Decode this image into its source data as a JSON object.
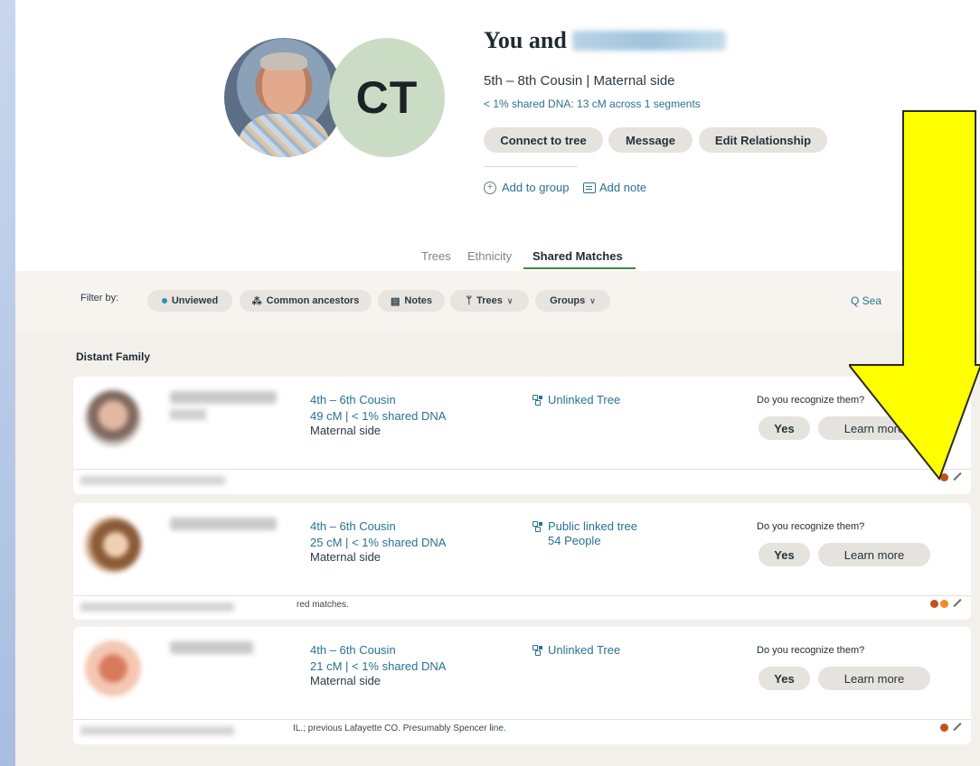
{
  "profile": {
    "initials": "CT",
    "title_prefix": "You and",
    "relationship": "5th – 8th Cousin | Maternal side",
    "shared_dna": "< 1% shared DNA: 13 cM across 1 segments",
    "buttons": {
      "connect": "Connect to tree",
      "message": "Message",
      "edit": "Edit Relationship"
    },
    "add_group": "Add to group",
    "add_note": "Add note"
  },
  "tabs": [
    "Trees",
    "Ethnicity",
    "Shared Matches"
  ],
  "filters": {
    "label": "Filter by:",
    "chips": [
      "Unviewed",
      "Common ancestors",
      "Notes",
      "Trees",
      "Groups"
    ],
    "search": "Q Sea"
  },
  "section_title": "Distant Family",
  "matches": [
    {
      "relationship": "4th – 6th Cousin",
      "dna": "49 cM | < 1% shared DNA",
      "side": "Maternal side",
      "tree": "Unlinked Tree",
      "tree_people": "",
      "question": "Do you recognize them?",
      "yes": "Yes",
      "learn": "Learn more",
      "note": "",
      "dots": [
        "#c2511a"
      ]
    },
    {
      "relationship": "4th – 6th Cousin",
      "dna": "25 cM | < 1% shared DNA",
      "side": "Maternal side",
      "tree": "Public linked tree",
      "tree_people": "54 People",
      "question": "Do you recognize them?",
      "yes": "Yes",
      "learn": "Learn more",
      "note": "red matches.",
      "dots": [
        "#c2511a",
        "#ee8a2a"
      ]
    },
    {
      "relationship": "4th – 6th Cousin",
      "dna": "21 cM | < 1% shared DNA",
      "side": "Maternal side",
      "tree": "Unlinked Tree",
      "tree_people": "",
      "question": "Do you recognize them?",
      "yes": "Yes",
      "learn": "Learn more",
      "note": "IL.; previous Lafayette CO. Presumably Spencer line.",
      "dots": [
        "#c2511a"
      ]
    }
  ],
  "colors": {
    "accent_link": "#2a7290",
    "tab_underline": "#3b8a3e",
    "arrow_fill": "#ffff00"
  }
}
